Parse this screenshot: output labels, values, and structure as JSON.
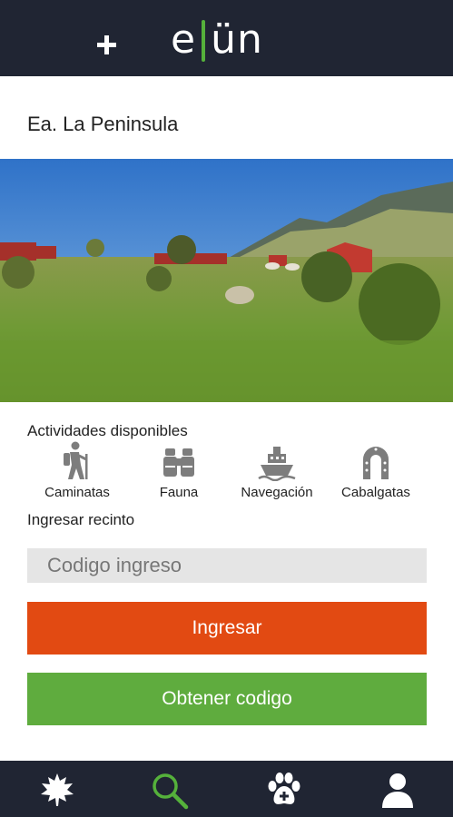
{
  "header": {
    "add_icon": "plus-icon",
    "logo_text_left": "e",
    "logo_text_right": "ün",
    "colors": {
      "background": "#202533",
      "accent": "#55b13b"
    }
  },
  "place": {
    "title": "Ea. La Peninsula",
    "photo": "landscape-photo"
  },
  "activities": {
    "heading": "Actividades disponibles",
    "items": [
      {
        "label": "Caminatas",
        "icon": "hiker-icon"
      },
      {
        "label": "Fauna",
        "icon": "binoculars-icon"
      },
      {
        "label": "Navegación",
        "icon": "ship-icon"
      },
      {
        "label": "Cabalgatas",
        "icon": "horseshoe-icon"
      }
    ]
  },
  "enter": {
    "heading": "Ingresar recinto",
    "code_placeholder": "Codigo ingreso",
    "submit_label": "Ingresar",
    "get_code_label": "Obtener codigo",
    "colors": {
      "submit": "#e24a12",
      "get_code": "#5fac3e"
    }
  },
  "bottom_nav": {
    "items": [
      {
        "icon": "leaf-icon",
        "active": false
      },
      {
        "icon": "search-icon",
        "active": true
      },
      {
        "icon": "paw-icon",
        "active": false
      },
      {
        "icon": "user-icon",
        "active": false
      }
    ],
    "colors": {
      "active": "#55b13b",
      "inactive": "#ffffff"
    }
  }
}
